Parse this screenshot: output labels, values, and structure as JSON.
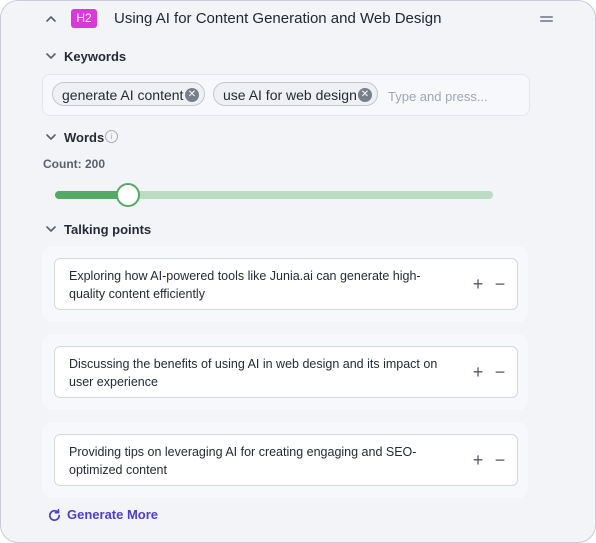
{
  "header": {
    "badge": "H2",
    "title": "Using AI for Content Generation and Web Design",
    "collapse_icon": "chevron-up-icon",
    "drag_icon": "drag-handle-icon"
  },
  "keywords": {
    "label": "Keywords",
    "chips": [
      {
        "text": "generate AI content"
      },
      {
        "text": "use AI for web design"
      }
    ],
    "placeholder": "Type and press..."
  },
  "words": {
    "label": "Words",
    "count_text": "Count: 200",
    "slider_fraction": 0.165
  },
  "talking_points": {
    "label": "Talking points",
    "items": [
      {
        "text": "Exploring how AI-powered tools like Junia.ai can generate high-quality content efficiently"
      },
      {
        "text": "Discussing the benefits of using AI in web design and its impact on user experience"
      },
      {
        "text": "Providing tips on leveraging AI for creating engaging and SEO-optimized content"
      }
    ]
  },
  "generate_more": {
    "label": "Generate More"
  },
  "colors": {
    "badge": "#d63ad9",
    "slider_fill": "#55a866",
    "slider_track": "#b9dcc3",
    "link": "#4f3fc7"
  }
}
